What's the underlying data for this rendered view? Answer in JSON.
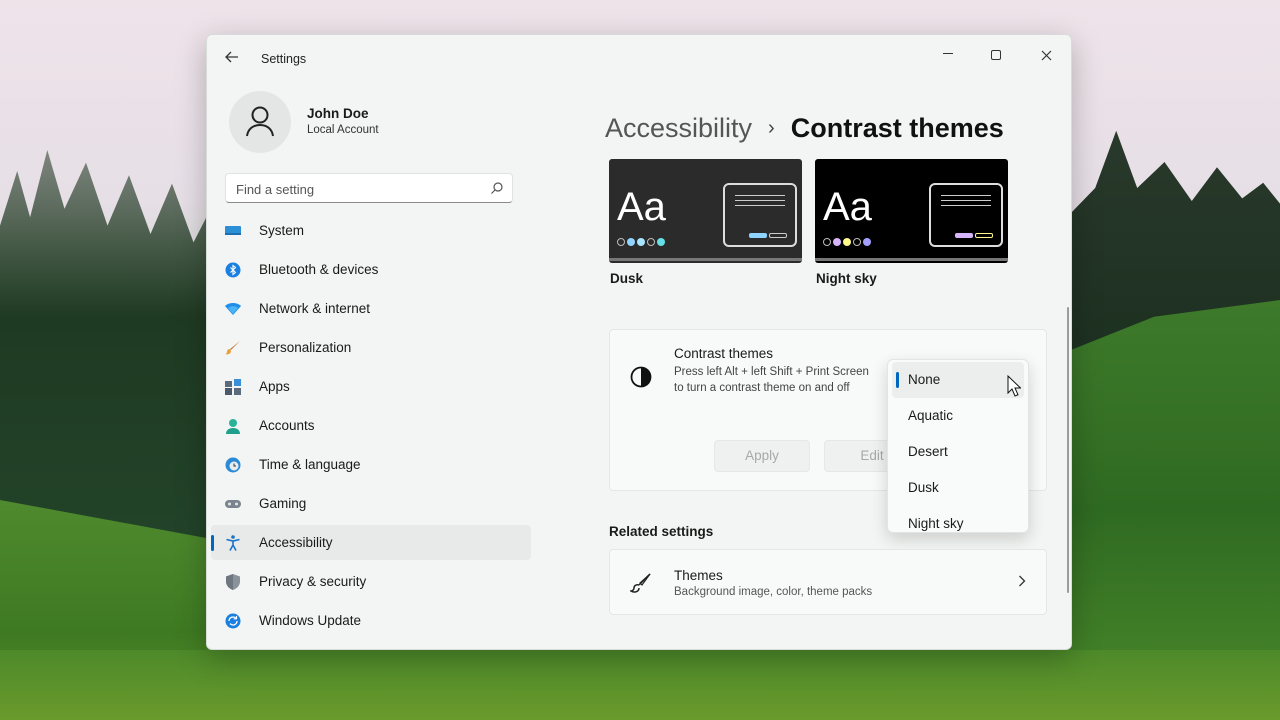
{
  "window": {
    "title": "Settings"
  },
  "profile": {
    "name": "John Doe",
    "account_type": "Local Account"
  },
  "search": {
    "placeholder": "Find a setting"
  },
  "nav": {
    "items": [
      {
        "label": "System",
        "icon": "monitor-icon"
      },
      {
        "label": "Bluetooth & devices",
        "icon": "bluetooth-icon"
      },
      {
        "label": "Network & internet",
        "icon": "wifi-icon"
      },
      {
        "label": "Personalization",
        "icon": "brush-icon"
      },
      {
        "label": "Apps",
        "icon": "apps-icon"
      },
      {
        "label": "Accounts",
        "icon": "person-icon"
      },
      {
        "label": "Time & language",
        "icon": "globe-clock-icon"
      },
      {
        "label": "Gaming",
        "icon": "gamepad-icon"
      },
      {
        "label": "Accessibility",
        "icon": "accessibility-icon",
        "active": true
      },
      {
        "label": "Privacy & security",
        "icon": "shield-icon"
      },
      {
        "label": "Windows Update",
        "icon": "update-icon"
      }
    ]
  },
  "breadcrumb": {
    "parent": "Accessibility",
    "separator": "›",
    "current": "Contrast themes"
  },
  "theme_previews": [
    {
      "name": "Dusk",
      "sample": "Aa",
      "background": "#2b2b2b",
      "dot_colors": [
        "#2b2b2b",
        "#8fd4ff",
        "#a6e4ff",
        "#2b2b2b",
        "#66e0e6"
      ]
    },
    {
      "name": "Night sky",
      "sample": "Aa",
      "background": "#000000",
      "dot_colors": [
        "#000000",
        "#d6b4fc",
        "#fff88a",
        "#000000",
        "#a29fff"
      ]
    }
  ],
  "contrast_panel": {
    "title": "Contrast themes",
    "description": "Press left Alt + left Shift + Print Screen to turn a contrast theme on and off",
    "apply_label": "Apply",
    "edit_label": "Edit"
  },
  "dropdown": {
    "selected": "None",
    "options": [
      "None",
      "Aquatic",
      "Desert",
      "Dusk",
      "Night sky"
    ]
  },
  "related": {
    "heading": "Related settings",
    "themes_title": "Themes",
    "themes_subtitle": "Background image, color, theme packs"
  },
  "colors": {
    "accent": "#0067c0"
  }
}
